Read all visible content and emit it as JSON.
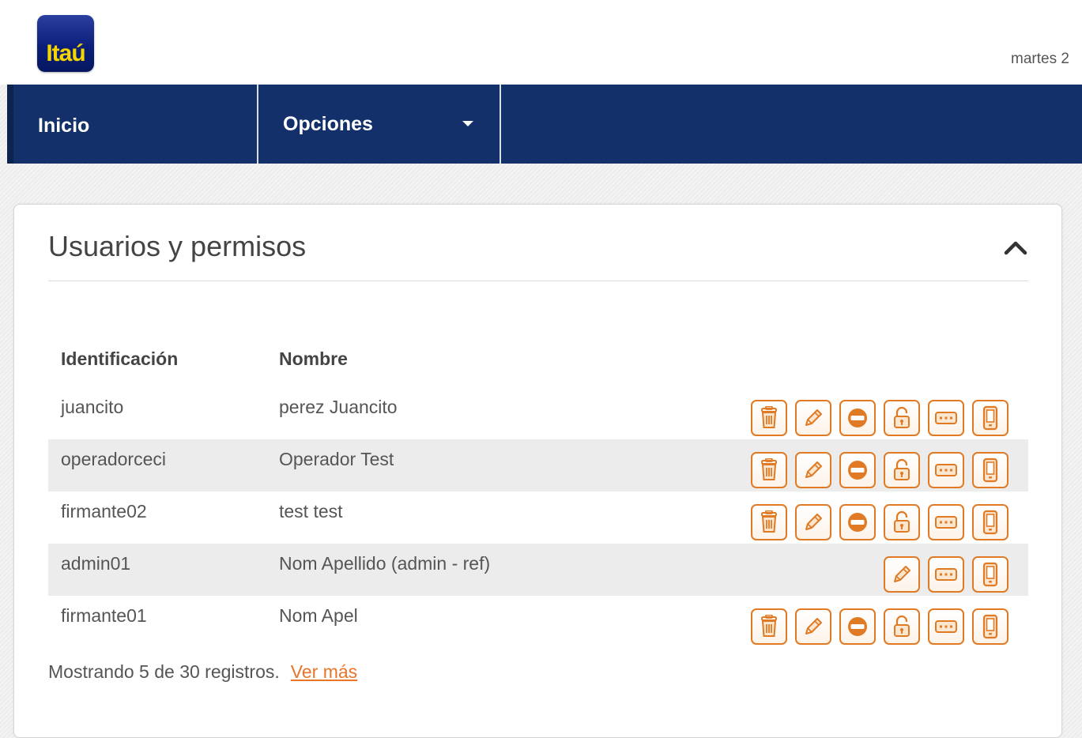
{
  "header": {
    "logo_text": "Itaú",
    "date_text": "martes 2"
  },
  "nav": {
    "items": [
      {
        "label": "Inicio"
      },
      {
        "label": "Opciones"
      }
    ]
  },
  "panel": {
    "title": "Usuarios y permisos",
    "columns": {
      "id": "Identificación",
      "name": "Nombre"
    },
    "rows": [
      {
        "id": "juancito",
        "name": "perez Juancito",
        "actions": [
          "delete",
          "edit",
          "block",
          "unlock",
          "password",
          "mobile"
        ]
      },
      {
        "id": "operadorceci",
        "name": "Operador Test",
        "actions": [
          "delete",
          "edit",
          "block",
          "unlock",
          "password",
          "mobile"
        ]
      },
      {
        "id": "firmante02",
        "name": "test test",
        "actions": [
          "delete",
          "edit",
          "block",
          "unlock",
          "password",
          "mobile"
        ]
      },
      {
        "id": "admin01",
        "name": "Nom Apellido (admin - ref)",
        "actions": [
          "edit",
          "password",
          "mobile"
        ]
      },
      {
        "id": "firmante01",
        "name": "Nom Apel",
        "actions": [
          "delete",
          "edit",
          "block",
          "unlock",
          "password",
          "mobile"
        ]
      }
    ],
    "footer_text": "Mostrando 5 de 30 registros.",
    "more_link": "Ver más"
  },
  "colors": {
    "nav_bg": "#13306a",
    "action_orange": "#e07a24",
    "link_orange": "#e8752a",
    "logo_yellow": "#f6d400"
  }
}
